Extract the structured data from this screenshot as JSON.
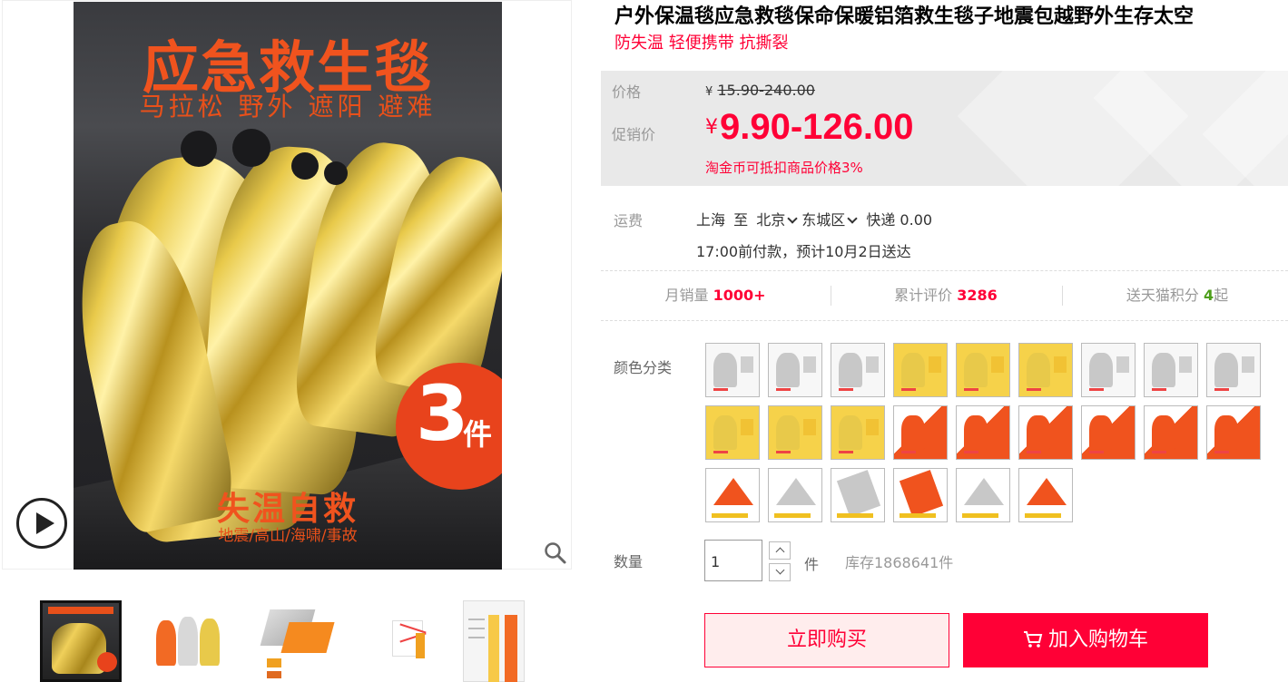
{
  "gallery": {
    "main": {
      "title": "应急救生毯",
      "subtitle": "马拉松 野外 遮阳 避难",
      "badge_number": "3",
      "badge_unit": "件",
      "bottom_text": "失温自救",
      "bottom_tags": "地震/高山/海啸/事故"
    },
    "play_icon": "play-circle-icon",
    "zoom_icon": "magnifier-icon",
    "thumbnails": [
      "thumb-1",
      "thumb-2",
      "thumb-3",
      "thumb-4",
      "thumb-5"
    ]
  },
  "product": {
    "title": "户外保温毯应急救毯保命保暖铝箔救生毯子地震包越野外生存太空",
    "subtitle": "防失温 轻便携带 抗撕裂"
  },
  "price": {
    "orig_label": "价格",
    "currency": "¥",
    "orig_value": "15.90-240.00",
    "promo_label": "促销价",
    "promo_value": "9.90-126.00",
    "coin_note": "淘金币可抵扣商品价格3%"
  },
  "shipping": {
    "label": "运费",
    "from": "上海",
    "to_word": "至",
    "city": "北京",
    "district": "东城区",
    "method": "快递 0.00",
    "eta": "17:00前付款，预计10月2日送达"
  },
  "stats": {
    "monthly_sales_label": "月销量",
    "monthly_sales_value": "1000+",
    "reviews_label": "累计评价",
    "reviews_value": "3286",
    "points_label": "送天猫积分",
    "points_value": "4",
    "points_suffix": "起"
  },
  "sku": {
    "color_label": "颜色分类"
  },
  "quantity": {
    "label": "数量",
    "value": "1",
    "unit": "件",
    "stock": "库存1868641件"
  },
  "actions": {
    "buy_now": "立即购买",
    "add_to_cart": "加入购物车"
  },
  "colors": {
    "accent": "#ff0036",
    "gold": "#e8c94a",
    "orange": "#f0531e",
    "silver": "#c8c8c8"
  }
}
